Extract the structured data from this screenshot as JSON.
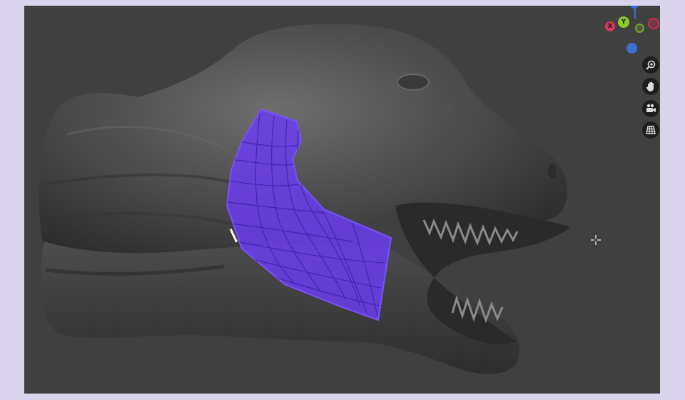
{
  "viewport": {
    "background": "#404040",
    "selection_color": "#6b3df0"
  },
  "gizmo": {
    "x_label": "X",
    "y_label": "Y",
    "colors": {
      "x": "#d9385a",
      "y": "#8ccb24",
      "z": "#3d6fd1"
    }
  },
  "nav_tools": [
    {
      "name": "zoom",
      "icon": "zoom-in-icon"
    },
    {
      "name": "pan",
      "icon": "hand-icon"
    },
    {
      "name": "camera",
      "icon": "camera-icon"
    },
    {
      "name": "grid",
      "icon": "grid-icon"
    }
  ]
}
